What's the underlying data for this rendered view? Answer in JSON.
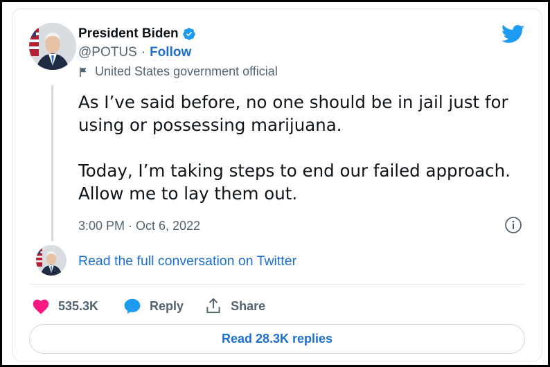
{
  "author": {
    "name": "President Biden",
    "handle": "@POTUS",
    "separator": "·",
    "follow_label": "Follow",
    "account_label": "United States government official",
    "avatar_icon": "president-portrait-avatar"
  },
  "tweet": {
    "text": "As I’ve said before, no one should be in jail just for using or possessing marijuana.\n\nToday, I’m taking steps to end our failed approach. Allow me to lay them out.",
    "timestamp": "3:00 PM · Oct 6, 2022"
  },
  "conversation_link": "Read the full conversation on Twitter",
  "actions": {
    "like_count": "535.3K",
    "reply_label": "Reply",
    "share_label": "Share"
  },
  "read_replies_label": "Read 28.3K replies",
  "colors": {
    "accent": "#1d6fcf",
    "like": "#f91880",
    "twitter_blue": "#1d9bf0",
    "secondary_text": "#536471"
  },
  "icons": [
    "verified-badge-icon",
    "flag-icon",
    "twitter-bird-icon",
    "info-icon",
    "heart-icon",
    "reply-bubble-icon",
    "share-icon"
  ]
}
